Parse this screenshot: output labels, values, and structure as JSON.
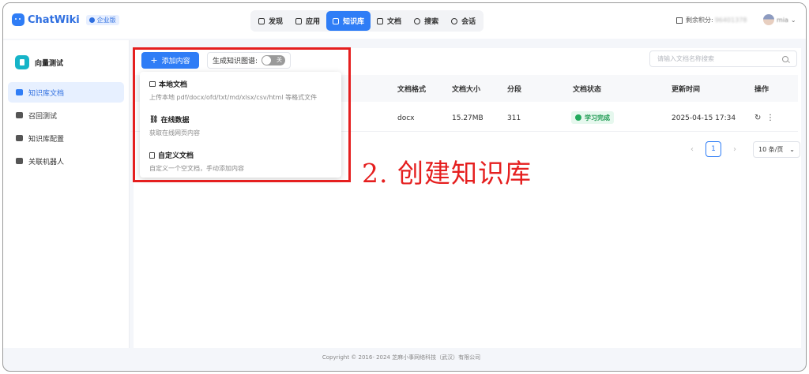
{
  "app": {
    "name": "ChatWiki",
    "edition": "企业版"
  },
  "nav": [
    {
      "label": "发现",
      "icon": "discover-icon",
      "active": false
    },
    {
      "label": "应用",
      "icon": "robot-icon",
      "active": false
    },
    {
      "label": "知识库",
      "icon": "library-icon",
      "active": true
    },
    {
      "label": "文档",
      "icon": "document-icon",
      "active": false
    },
    {
      "label": "搜索",
      "icon": "search-icon",
      "active": false
    },
    {
      "label": "会话",
      "icon": "chat-icon",
      "active": false
    }
  ],
  "header": {
    "points_label": "剩余积分:",
    "points_value": "96401378",
    "user_name": "mia"
  },
  "sidebar": {
    "kb_title": "向量测试",
    "items": [
      {
        "label": "知识库文档",
        "active": true
      },
      {
        "label": "召回测试",
        "active": false
      },
      {
        "label": "知识库配置",
        "active": false
      },
      {
        "label": "关联机器人",
        "active": false
      }
    ]
  },
  "toolbar": {
    "add_label": "添加内容",
    "graph_label": "生成知识图谱:",
    "graph_toggle": "关",
    "search_placeholder": "请输入文档名称搜索"
  },
  "table": {
    "columns": [
      "文档格式",
      "文档大小",
      "分段",
      "文档状态",
      "更新时间",
      "操作"
    ],
    "rows": [
      {
        "format": "docx",
        "size": "15.27MB",
        "segments": "311",
        "status": "学习完成",
        "updated": "2025-04-15 17:34"
      }
    ]
  },
  "pagination": {
    "current": "1",
    "page_size": "10 条/页"
  },
  "dropdown": [
    {
      "title": "本地文档",
      "desc": "上传本地 pdf/docx/ofd/txt/md/xlsx/csv/html 等格式文件",
      "icon": "folder-icon"
    },
    {
      "title": "在线数据",
      "desc": "获取在线网页内容",
      "icon": "link-icon"
    },
    {
      "title": "自定义文档",
      "desc": "自定义一个空文档，手动添加内容",
      "icon": "file-icon"
    }
  ],
  "annotation": "2. 创建知识库",
  "footer": "Copyright © 2016- 2024 芝麻小事网络科技（武汉）有限公司",
  "colors": {
    "accent": "#2f7df6",
    "annotation": "#e51f1f",
    "success": "#22aa5c"
  }
}
